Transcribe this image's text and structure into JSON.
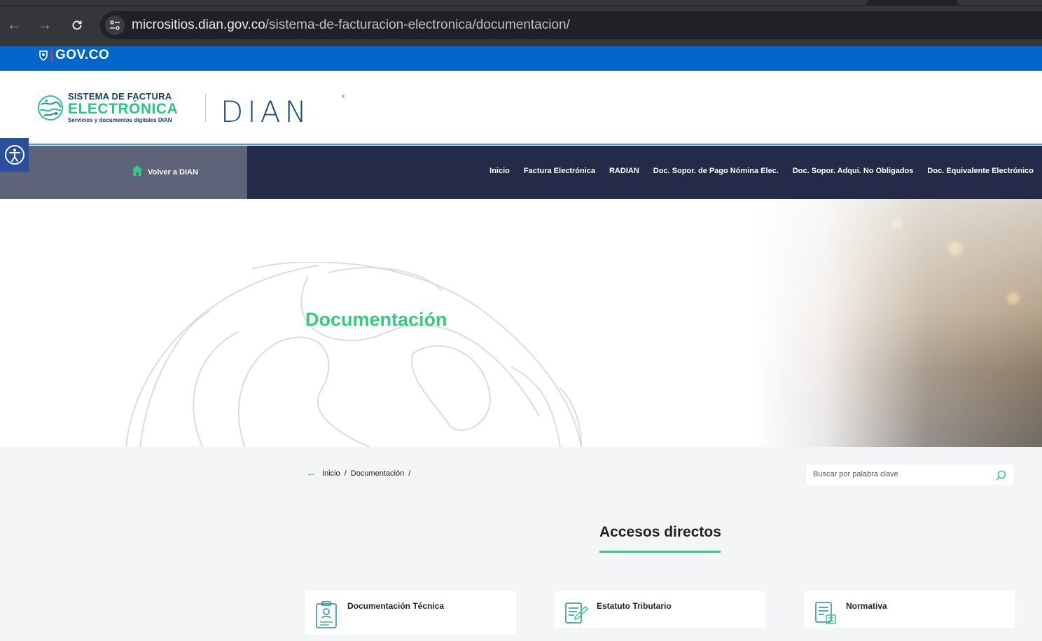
{
  "browser": {
    "url_host": "micrositios.dian.gov.co",
    "url_path": "/sistema-de-facturacion-electronica/documentacion/"
  },
  "govbar": {
    "label": "GOV.CO"
  },
  "header": {
    "logo_line1": "SISTEMA DE FACTURA",
    "logo_line2": "ELECTRÓNICA",
    "logo_line3": "Servicios y documentos digitales DIAN",
    "dian": "DIAN"
  },
  "nav": {
    "back_label": "Volver a DIAN",
    "items": [
      "Inicio",
      "Factura Electrónica",
      "RADIAN",
      "Doc. Sopor. de Pago Nómina Elec.",
      "Doc. Sopor. Adqui. No Obligados",
      "Doc. Equivalente Electrónico"
    ]
  },
  "hero": {
    "title": "Documentación"
  },
  "breadcrumb": {
    "items": [
      "Inicio",
      "Documentación"
    ],
    "separator": "/"
  },
  "search": {
    "placeholder": "Buscar por palabra clave"
  },
  "section": {
    "title": "Accesos directos"
  },
  "cards": [
    {
      "label": "Documentación Técnica",
      "icon": "technical-doc-icon"
    },
    {
      "label": "Estatuto Tributario",
      "icon": "tax-statute-icon"
    },
    {
      "label": "Normativa",
      "icon": "regulations-icon"
    }
  ],
  "colors": {
    "gov_blue": "#0066cc",
    "nav_dark": "#232b48",
    "accent_green": "#34cc7e"
  }
}
